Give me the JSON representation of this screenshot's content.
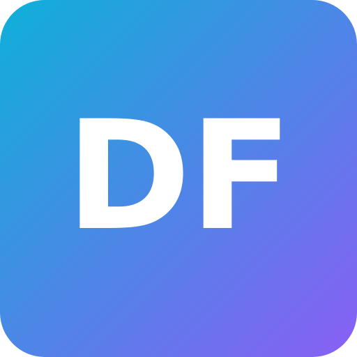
{
  "app_icon": {
    "monogram": "DF",
    "gradient_start_color": "#0eb0d8",
    "gradient_end_color": "#8a5ef5",
    "text_color": "#ffffff"
  }
}
